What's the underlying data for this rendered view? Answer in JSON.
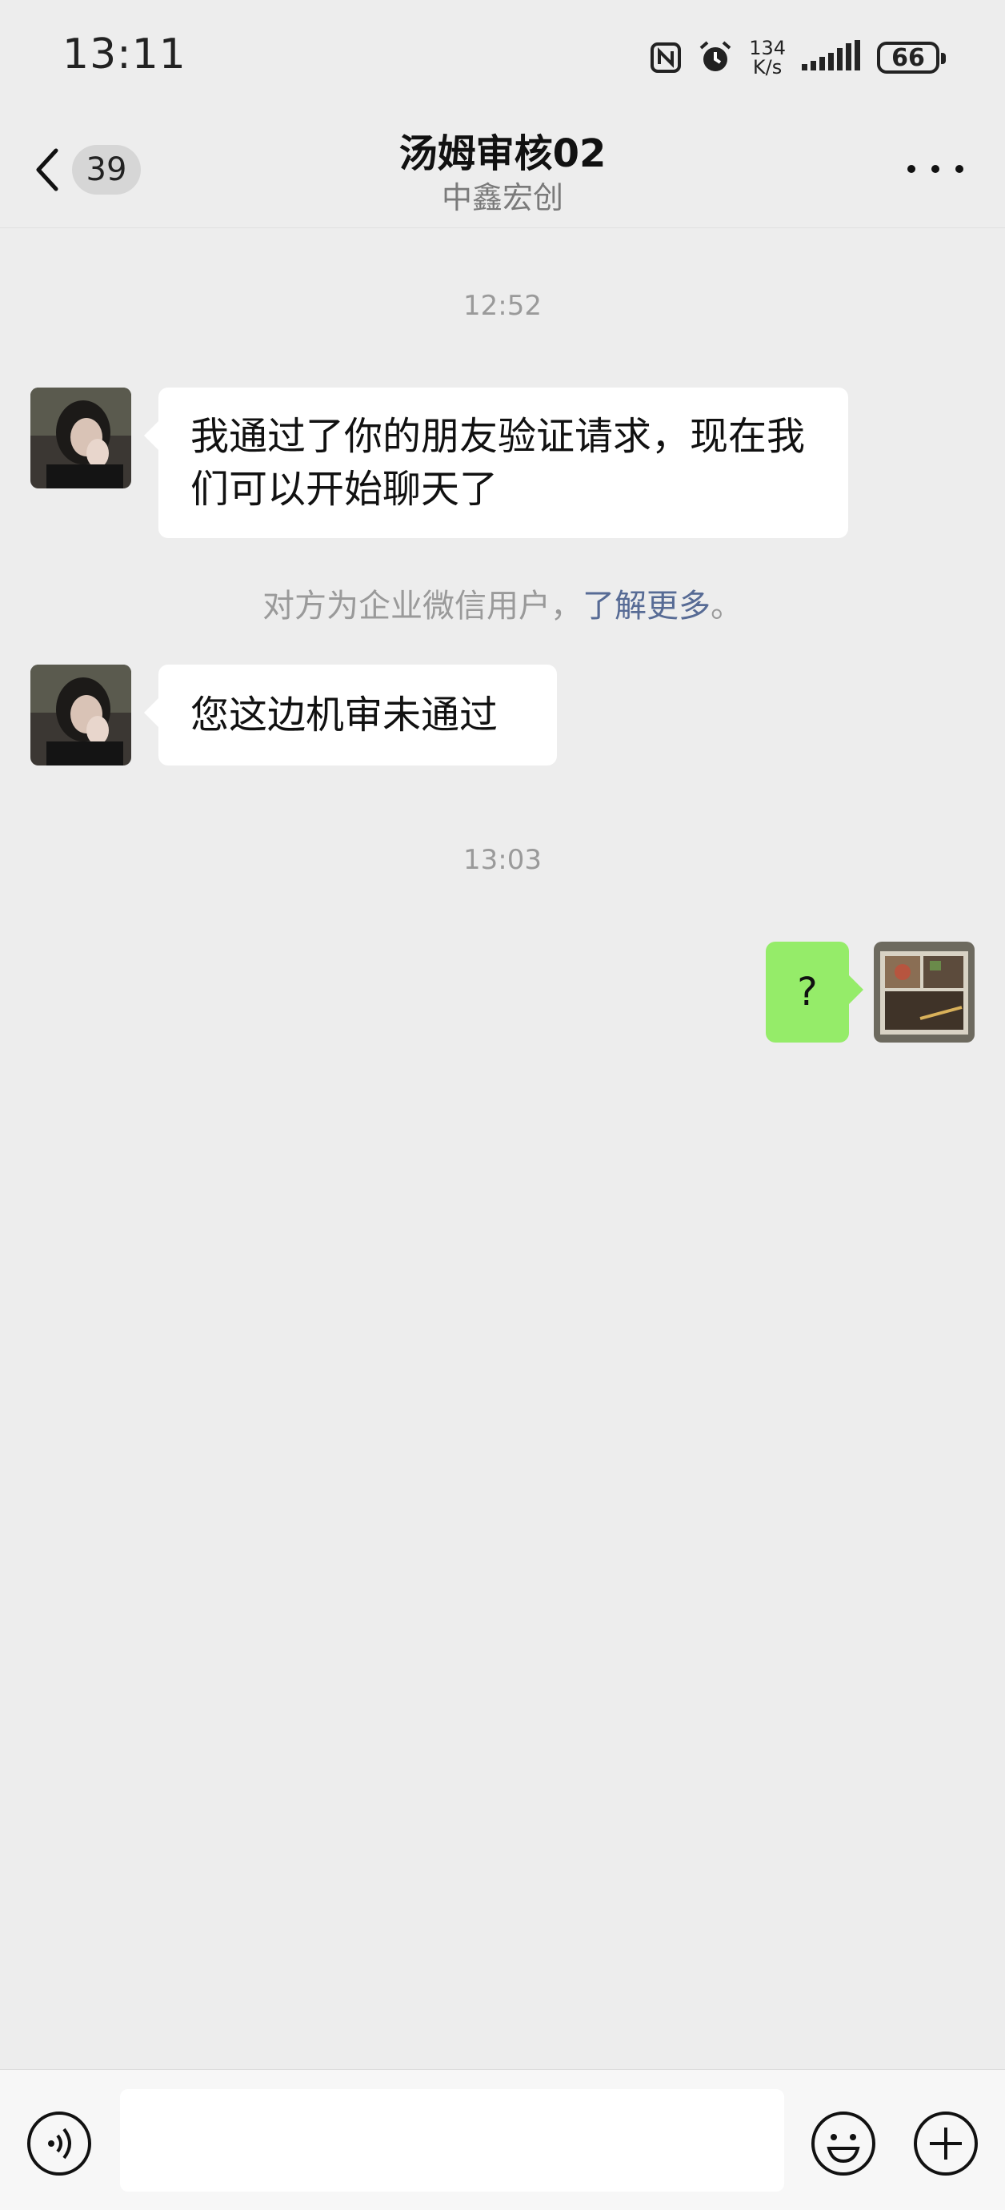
{
  "status_bar": {
    "time": "13:11",
    "net_speed_value": "134",
    "net_speed_unit": "K/s",
    "battery": "66",
    "icons": [
      "nfc-icon",
      "alarm-icon",
      "signal-icon",
      "battery-icon"
    ]
  },
  "header": {
    "unread_count": "39",
    "title": "汤姆审核02",
    "subtitle": "中鑫宏创",
    "icons": [
      "back-chevron-icon",
      "more-icon"
    ]
  },
  "messages": {
    "time_1": "12:52",
    "msg_1": "我通过了你的朋友验证请求，现在我们可以开始聊天了",
    "notice_text": "对方为企业微信用户，",
    "notice_link": "了解更多",
    "notice_end": "。",
    "msg_2": "您这边机审未通过",
    "time_2": "13:03",
    "msg_3": "?"
  },
  "input_bar": {
    "placeholder": "",
    "icons": [
      "voice-icon",
      "emoji-icon",
      "plus-icon"
    ]
  },
  "colors": {
    "background": "#ededed",
    "self_bubble": "#95ec69",
    "other_bubble": "#ffffff",
    "link": "#576b95"
  }
}
